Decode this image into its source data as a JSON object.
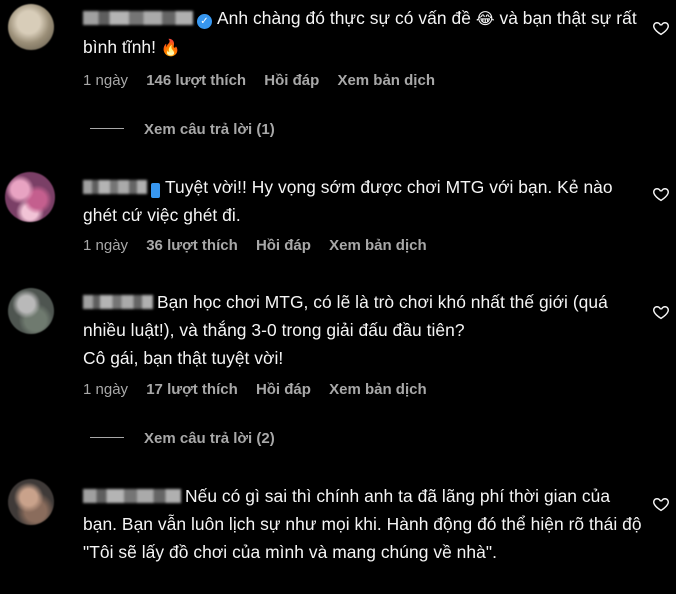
{
  "comments": [
    {
      "text": "Anh chàng đó thực sự có vấn đề",
      "emoji": "😂",
      "text_b": "và bạn thật sự rất bình tĩnh!",
      "emoji_b": "🔥",
      "time": "1 ngày",
      "likes": "146 lượt thích",
      "reply": "Hồi đáp",
      "translate": "Xem bản dịch",
      "view_replies": "Xem câu trả lời (1)",
      "verified": true
    },
    {
      "text": "Tuyệt vời!! Hy vọng sớm được chơi MTG với bạn. Kẻ nào ghét cứ việc ghét đi.",
      "time": "1 ngày",
      "likes": "36 lượt thích",
      "reply": "Hồi đáp",
      "translate": "Xem bản dịch"
    },
    {
      "text": "Bạn học chơi MTG, có lẽ là trò chơi khó nhất thế giới (quá nhiều luật!), và thắng 3-0 trong giải đấu đầu tiên?",
      "text_b": "Cô gái, bạn thật tuyệt vời!",
      "time": "1 ngày",
      "likes": "17 lượt thích",
      "reply": "Hồi đáp",
      "translate": "Xem bản dịch",
      "view_replies": "Xem câu trả lời (2)"
    },
    {
      "text": "Nếu có gì sai thì chính anh ta đã lãng phí thời gian của bạn. Bạn vẫn luôn lịch sự như mọi khi. Hành động đó thể hiện rõ thái độ \"Tôi sẽ lấy đồ chơi của mình và mang chúng về nhà\"."
    }
  ],
  "colors": {
    "background": "#000000",
    "text": "#f5f5f5",
    "muted": "#a8a8a8",
    "verified": "#3797f0"
  },
  "icons": {
    "like": "heart-outline-icon",
    "verified": "verified-badge-icon"
  }
}
